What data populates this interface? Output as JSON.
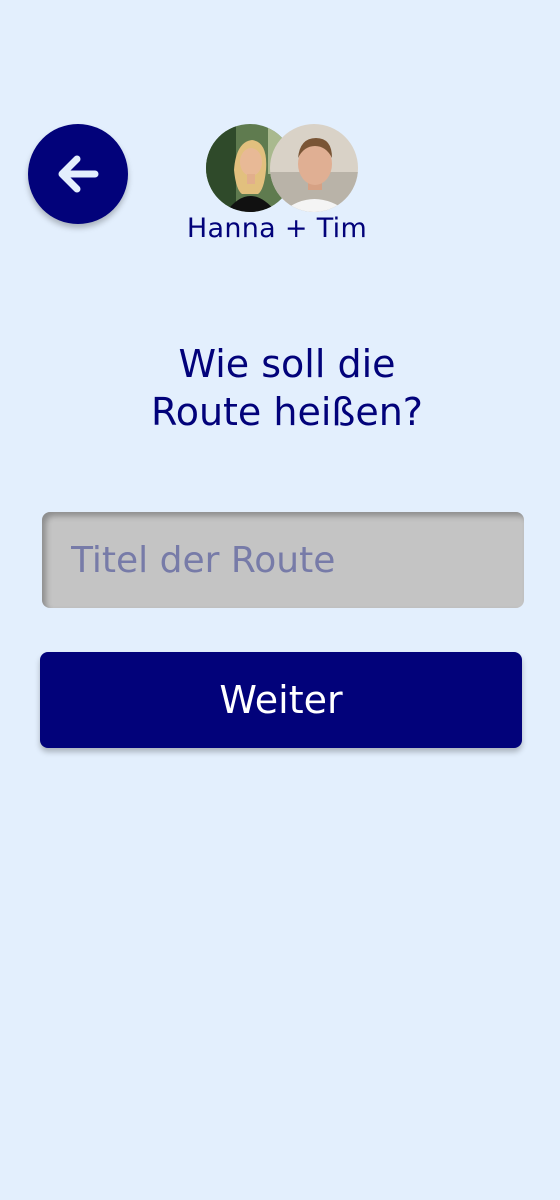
{
  "header": {
    "back_icon": "arrow-left-icon",
    "participants": "Hanna + Tim"
  },
  "question": {
    "line1": "Wie soll die",
    "line2": "Route heißen?"
  },
  "route_title_input": {
    "placeholder": "Titel der Route",
    "value": ""
  },
  "next_button": {
    "label": "Weiter"
  },
  "colors": {
    "background": "#E3EFFD",
    "primary": "#02027A",
    "input_background": "#C4C4C4",
    "placeholder": "#777BA8"
  }
}
